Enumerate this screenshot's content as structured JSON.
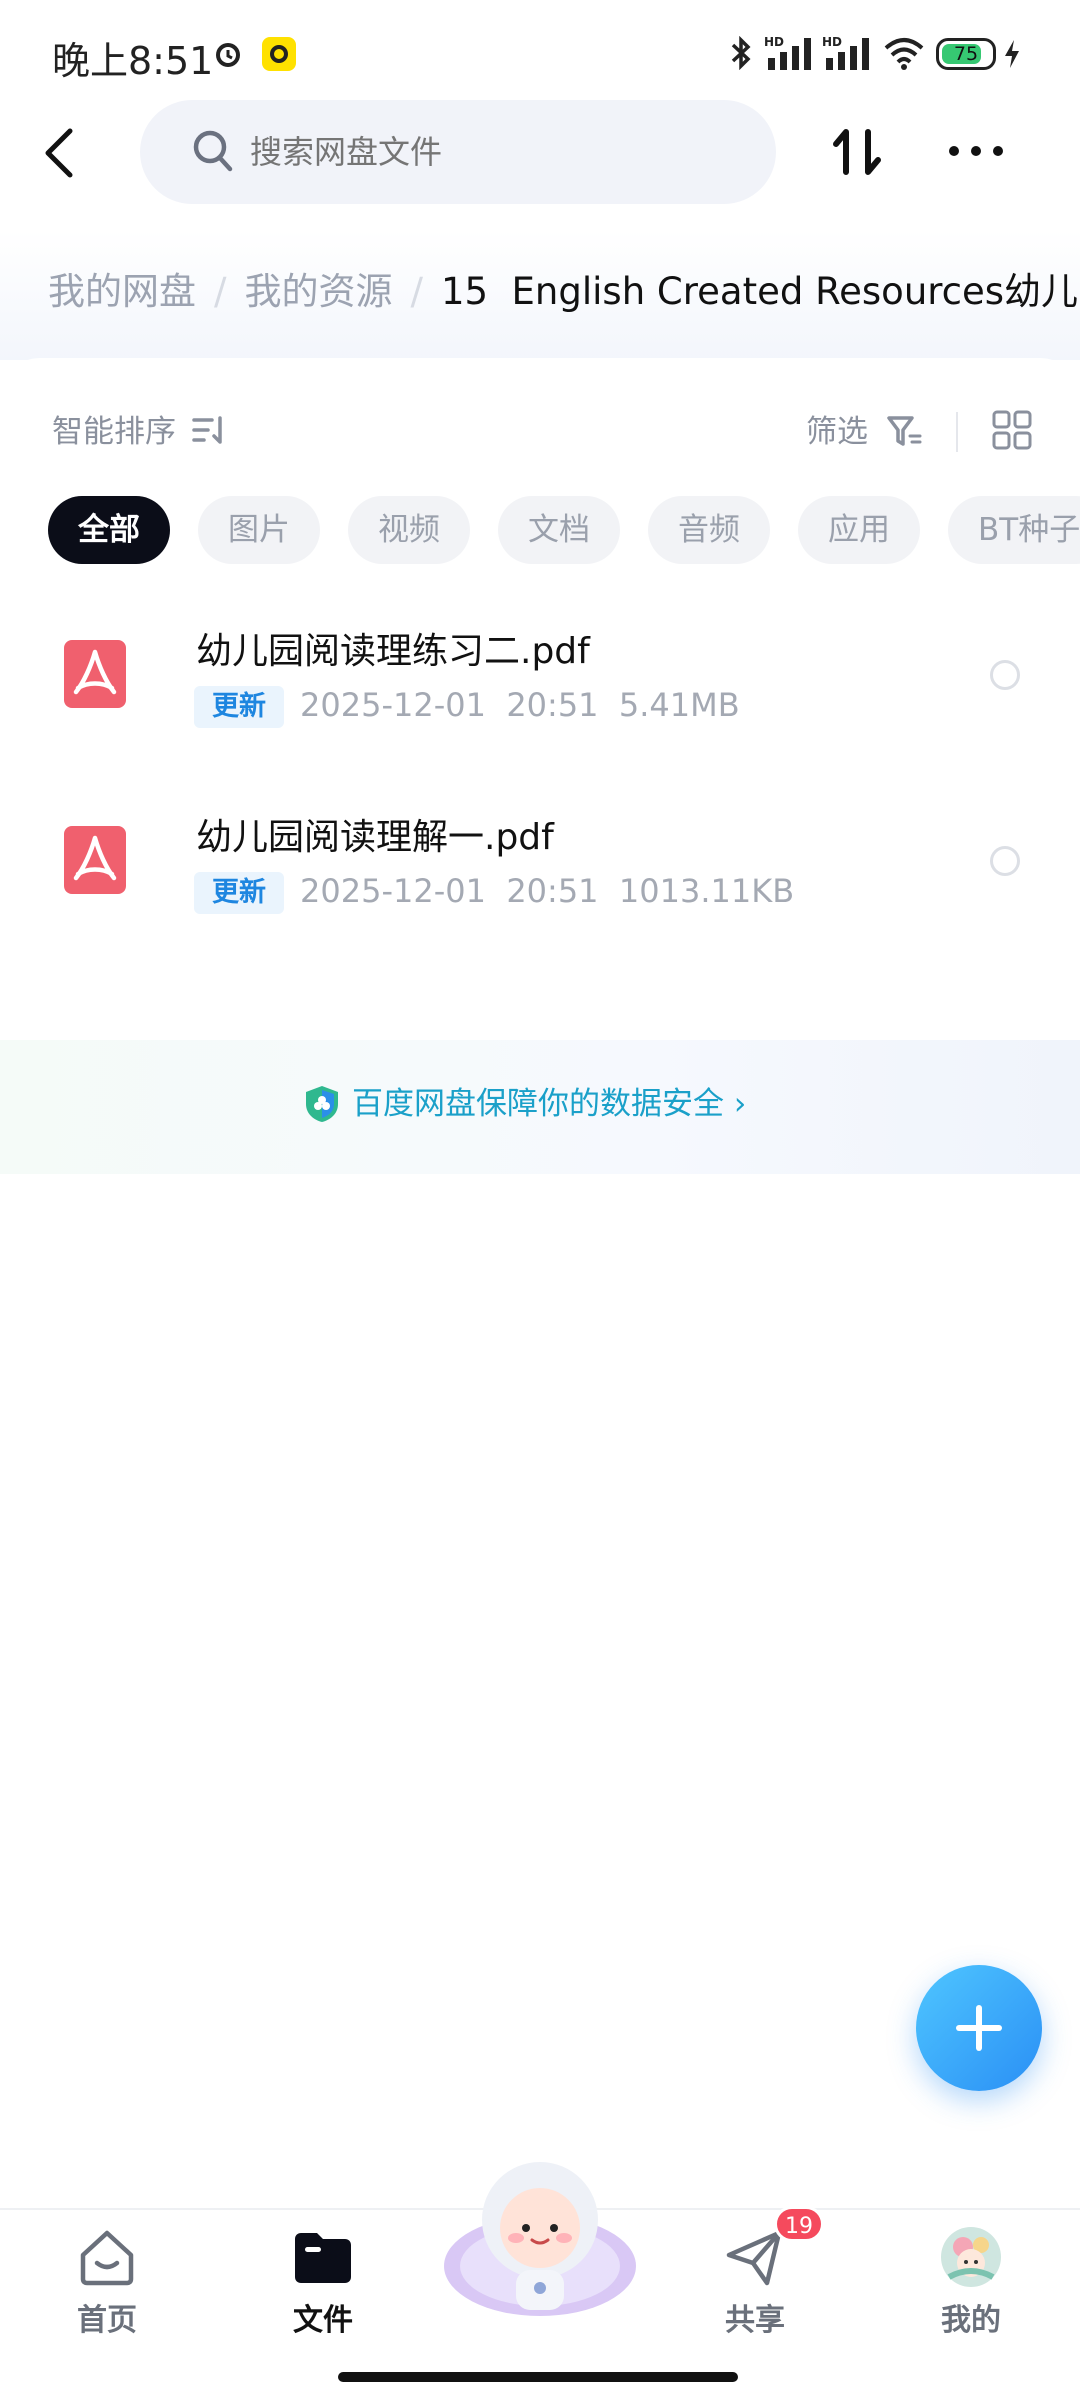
{
  "status_bar": {
    "time": "晚上8:51",
    "battery_level": "75"
  },
  "search": {
    "placeholder": "搜索网盘文件"
  },
  "breadcrumb": [
    {
      "label": "我的网盘"
    },
    {
      "label": "我的资源"
    },
    {
      "label": "15  English Created Resources幼儿"
    }
  ],
  "toolbar": {
    "sort_label": "智能排序",
    "filter_label": "筛选"
  },
  "filter_chips": [
    {
      "label": "全部",
      "active": true
    },
    {
      "label": "图片",
      "active": false
    },
    {
      "label": "视频",
      "active": false
    },
    {
      "label": "文档",
      "active": false
    },
    {
      "label": "音频",
      "active": false
    },
    {
      "label": "应用",
      "active": false
    },
    {
      "label": "BT种子",
      "active": false
    }
  ],
  "files": [
    {
      "name": "幼儿园阅读理练习二.pdf",
      "badge": "更新",
      "meta": "2025-12-01  20:51  5.41MB",
      "icon": "pdf-icon"
    },
    {
      "name": "幼儿园阅读理解一.pdf",
      "badge": "更新",
      "meta": "2025-12-01  20:51  1013.11KB",
      "icon": "pdf-icon"
    }
  ],
  "security_banner": {
    "text": "百度网盘保障你的数据安全",
    "color": "#1aa0c9"
  },
  "bottom_nav": [
    {
      "label": "首页",
      "icon": "home-icon",
      "active": false
    },
    {
      "label": "文件",
      "icon": "folder-icon",
      "active": true
    },
    {
      "label": "",
      "icon": "mascot-icon",
      "active": false
    },
    {
      "label": "共享",
      "icon": "share-icon",
      "active": false,
      "badge": "19"
    },
    {
      "label": "我的",
      "icon": "avatar",
      "active": false
    }
  ],
  "colors": {
    "accent": "#2a8ff5",
    "chip_active_bg": "#0b0d18",
    "badge_red": "#f54a5d",
    "pdf_red": "#f0606e"
  }
}
